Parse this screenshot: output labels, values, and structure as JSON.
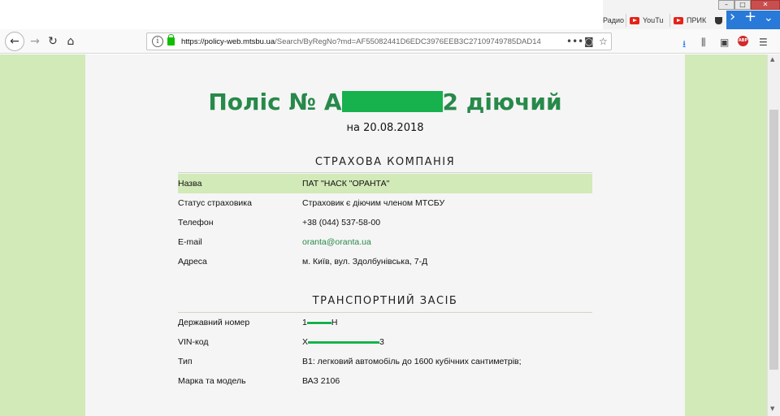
{
  "browser": {
    "tabs": [
      {
        "label": "Радио",
        "icon": "music-icon"
      },
      {
        "label": "YouTu",
        "icon": "youtube-icon"
      },
      {
        "label": "ПРИК",
        "icon": "youtube-icon"
      }
    ],
    "url_host": "https://policy-web.mtsbu.ua",
    "url_path": "/Search/ByRegNo?md=AF55082441D6EDC3976EEB3C27109749785DAD14",
    "new_tab_label": "+"
  },
  "policy": {
    "title_prefix": "Поліс № А",
    "title_suffix": "2 діючий",
    "date_line": "на 20.08.2018"
  },
  "insurer": {
    "heading": "СТРАХОВА КОМПАНІЯ",
    "rows": [
      {
        "label": "Назва",
        "value": "ПАТ \"НАСК \"ОРАНТА\""
      },
      {
        "label": "Статус страховика",
        "value": "Страховик є діючим членом МТСБУ"
      },
      {
        "label": "Телефон",
        "value": "+38 (044) 537-58-00"
      },
      {
        "label": "E-mail",
        "value": "oranta@oranta.ua"
      },
      {
        "label": "Адреса",
        "value": "м. Київ, вул. Здолбунівська, 7-Д"
      }
    ]
  },
  "vehicle": {
    "heading": "ТРАНСПОРТНИЙ ЗАСІБ",
    "reg_label": "Державний номер",
    "reg_prefix": "1",
    "reg_suffix": "Н",
    "vin_label": "VIN-код",
    "vin_prefix": "Х",
    "vin_suffix": "3",
    "type_label": "Тип",
    "type_value": "В1: легковий автомобіль до 1600 кубічних сантиметрів;",
    "model_label": "Марка та модель",
    "model_value": "ВАЗ 2106"
  },
  "colors": {
    "accent_green": "#27894a",
    "page_bg": "#d2e9b8",
    "redaction": "#17b14d"
  }
}
